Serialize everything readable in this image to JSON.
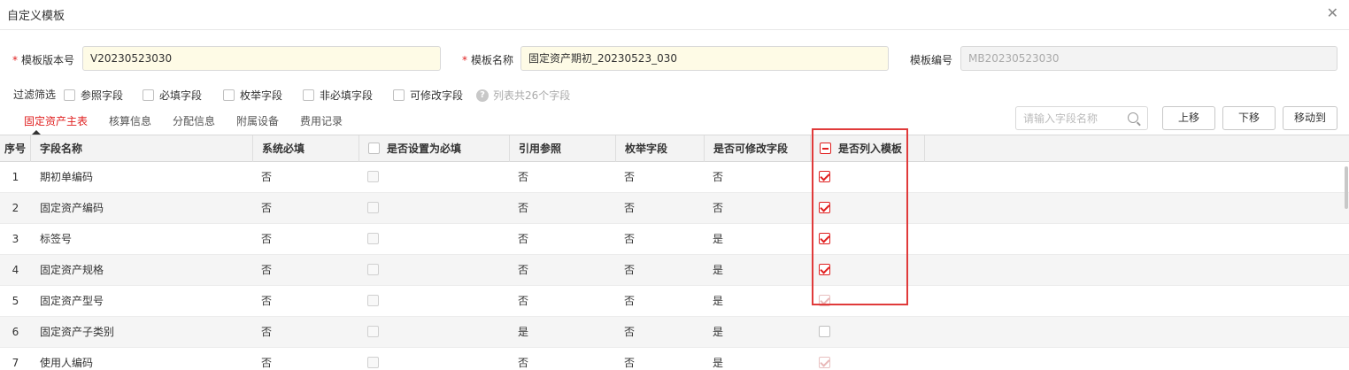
{
  "dialog": {
    "title": "自定义模板",
    "close_icon": "close-icon"
  },
  "form": {
    "version_label": "模板版本号",
    "version_value": "V20230523030",
    "name_label": "模板名称",
    "name_value": "固定资产期初_20230523_030",
    "code_label": "模板编号",
    "code_value": "MB20230523030",
    "required_mark": "*"
  },
  "filter": {
    "label": "过滤筛选",
    "options": [
      "参照字段",
      "必填字段",
      "枚举字段",
      "非必填字段",
      "可修改字段"
    ],
    "info": "列表共26个字段"
  },
  "tabs": [
    {
      "label": "固定资产主表",
      "active": true
    },
    {
      "label": "核算信息",
      "active": false
    },
    {
      "label": "分配信息",
      "active": false
    },
    {
      "label": "附属设备",
      "active": false
    },
    {
      "label": "费用记录",
      "active": false
    }
  ],
  "search": {
    "placeholder": "请输入字段名称"
  },
  "buttons": {
    "up": "上移",
    "down": "下移",
    "move_to": "移动到"
  },
  "table": {
    "headers": [
      "序号",
      "字段名称",
      "系统必填",
      "是否设置为必填",
      "引用参照",
      "枚举字段",
      "是否可修改字段",
      "是否列入模板"
    ],
    "rows": [
      {
        "no": "1",
        "name": "期初单编码",
        "sys_req": "否",
        "set_req": false,
        "ref": "否",
        "enum": "否",
        "editable": "否",
        "included": true
      },
      {
        "no": "2",
        "name": "固定资产编码",
        "sys_req": "否",
        "set_req": false,
        "ref": "否",
        "enum": "否",
        "editable": "否",
        "included": true
      },
      {
        "no": "3",
        "name": "标签号",
        "sys_req": "否",
        "set_req": false,
        "ref": "否",
        "enum": "否",
        "editable": "是",
        "included": true
      },
      {
        "no": "4",
        "name": "固定资产规格",
        "sys_req": "否",
        "set_req": false,
        "ref": "否",
        "enum": "否",
        "editable": "是",
        "included": true
      },
      {
        "no": "5",
        "name": "固定资产型号",
        "sys_req": "否",
        "set_req": false,
        "ref": "否",
        "enum": "否",
        "editable": "是",
        "included": true
      },
      {
        "no": "6",
        "name": "固定资产子类别",
        "sys_req": "否",
        "set_req": false,
        "ref": "是",
        "enum": "否",
        "editable": "是",
        "included": false
      },
      {
        "no": "7",
        "name": "使用人编码",
        "sys_req": "否",
        "set_req": false,
        "ref": "否",
        "enum": "否",
        "editable": "是",
        "included": true
      }
    ]
  },
  "colors": {
    "accent": "#e02020",
    "highlight_box": "#e03a3a",
    "required_input_bg": "#fefbe6"
  }
}
